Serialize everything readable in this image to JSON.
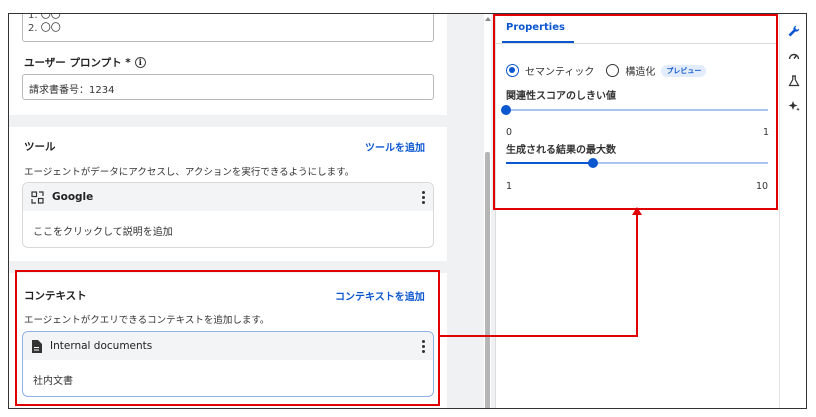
{
  "prompt_field": {
    "textarea_lines": [
      "1. 〇〇",
      "2. 〇〇"
    ],
    "user_prompt_label": "ユーザー プロンプト *",
    "user_prompt_value": "請求書番号：1234"
  },
  "tools": {
    "title": "ツール",
    "add_link": "ツールを追加",
    "description": "エージェントがデータにアクセスし、アクションを実行できるようにします。",
    "card": {
      "name": "Google",
      "description": "ここをクリックして説明を追加"
    }
  },
  "context": {
    "title": "コンテキスト",
    "add_link": "コンテキストを追加",
    "description": "エージェントがクエリできるコンテキストを追加します。",
    "card": {
      "name": "Internal documents",
      "description": "社内文書"
    }
  },
  "properties": {
    "tab_label": "Properties",
    "radio_semantic": "セマンティック",
    "radio_structured": "構造化",
    "preview_badge": "プレビュー",
    "threshold_label": "関連性スコアのしきい値",
    "threshold_min": "0",
    "threshold_max": "1",
    "threshold_value": 0,
    "max_results_label": "生成される結果の最大数",
    "max_results_min": "1",
    "max_results_max": "10",
    "max_results_value": 4
  },
  "icons": {
    "toolbar": [
      "wrench-icon",
      "gauge-icon",
      "flask-icon",
      "sparkle-icon"
    ]
  },
  "colors": {
    "accent": "#0b57d0",
    "highlight": "#e00000"
  }
}
